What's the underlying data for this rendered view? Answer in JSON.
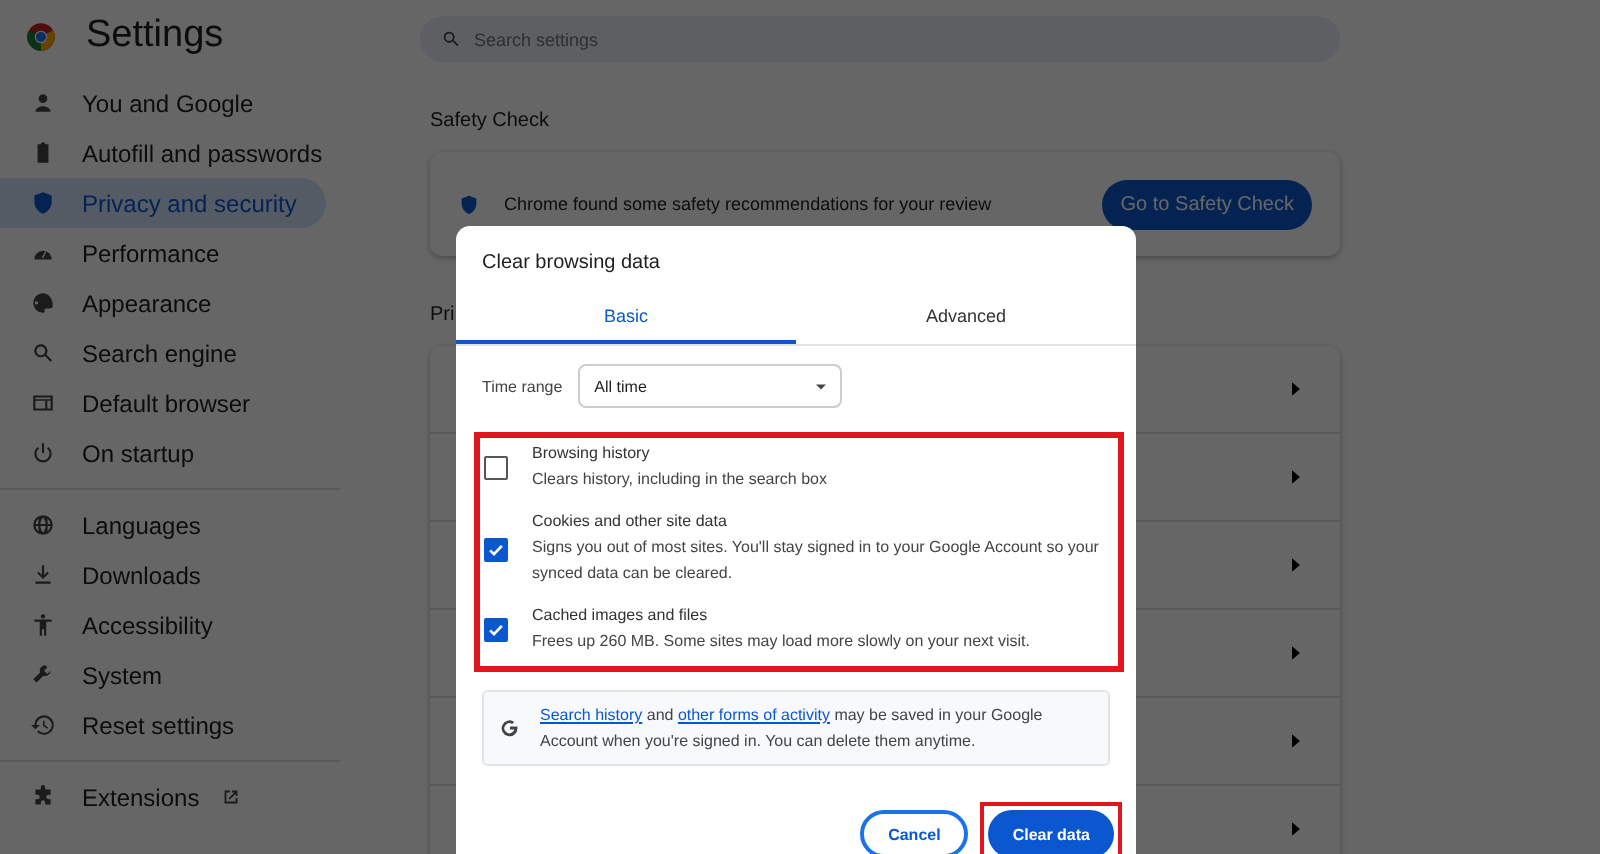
{
  "header": {
    "title": "Settings",
    "search": {
      "placeholder": "Search settings"
    }
  },
  "sidebar": {
    "sections": [
      {
        "items": [
          {
            "label": "You and Google",
            "selected": false
          },
          {
            "label": "Autofill and passwords",
            "selected": false
          },
          {
            "label": "Privacy and security",
            "selected": true
          },
          {
            "label": "Performance",
            "selected": false
          },
          {
            "label": "Appearance",
            "selected": false
          },
          {
            "label": "Search engine",
            "selected": false
          },
          {
            "label": "Default browser",
            "selected": false
          },
          {
            "label": "On startup",
            "selected": false
          }
        ]
      },
      {
        "items": [
          {
            "label": "Languages",
            "selected": false
          },
          {
            "label": "Downloads",
            "selected": false
          },
          {
            "label": "Accessibility",
            "selected": false
          },
          {
            "label": "System",
            "selected": false
          },
          {
            "label": "Reset settings",
            "selected": false
          }
        ]
      },
      {
        "items": [
          {
            "label": "Extensions",
            "selected": false,
            "external": true
          }
        ]
      }
    ]
  },
  "safety_check": {
    "heading": "Safety Check",
    "message": "Chrome found some safety recommendations for your review",
    "button": "Go to Safety Check"
  },
  "privacy_section": {
    "heading": "Pri"
  },
  "dialog": {
    "title": "Clear browsing data",
    "tabs": [
      {
        "label": "Basic",
        "selected": true
      },
      {
        "label": "Advanced",
        "selected": false
      }
    ],
    "time_range": {
      "label": "Time range",
      "value": "All time"
    },
    "options_highlighted": true,
    "options": [
      {
        "title": "Browsing history",
        "description": "Clears history, including in the search box",
        "checked": false
      },
      {
        "title": "Cookies and other site data",
        "description": "Signs you out of most sites. You'll stay signed in to your Google Account so your synced data can be cleared.",
        "checked": true
      },
      {
        "title": "Cached images and files",
        "description": "Frees up 260 MB. Some sites may load more slowly on your next visit.",
        "checked": true
      }
    ],
    "info": {
      "link_1": "Search history",
      "text_1": "and",
      "link_2": "other forms of activity",
      "text_2": "may be saved in your Google Account when you're signed in. You can delete them anytime."
    },
    "buttons": [
      {
        "label": "Cancel",
        "kind": "secondary",
        "highlighted": false
      },
      {
        "label": "Clear data",
        "kind": "primary",
        "highlighted": true
      }
    ]
  }
}
